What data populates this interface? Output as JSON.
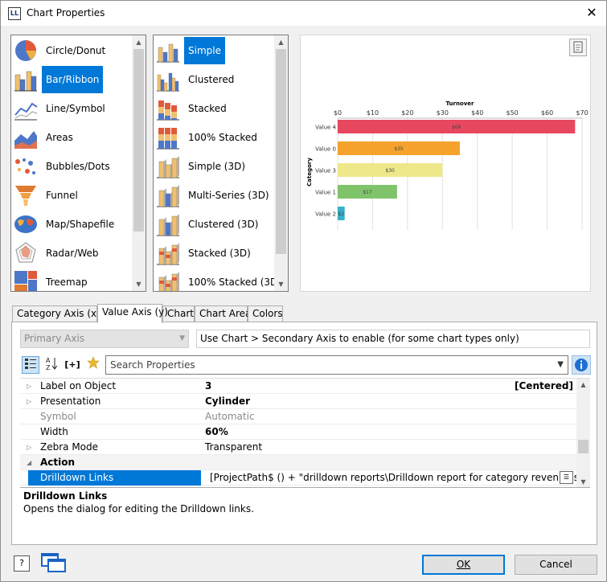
{
  "window": {
    "title": "Chart Properties",
    "app_icon_text": "LL",
    "close_label": "✕"
  },
  "chart_types": {
    "items": [
      {
        "label": "Circle/Donut",
        "icon": "pie-chart-icon"
      },
      {
        "label": "Bar/Ribbon",
        "icon": "bar-chart-icon",
        "selected": true
      },
      {
        "label": "Line/Symbol",
        "icon": "line-chart-icon"
      },
      {
        "label": "Areas",
        "icon": "area-chart-icon"
      },
      {
        "label": "Bubbles/Dots",
        "icon": "bubble-chart-icon"
      },
      {
        "label": "Funnel",
        "icon": "funnel-chart-icon"
      },
      {
        "label": "Map/Shapefile",
        "icon": "map-icon"
      },
      {
        "label": "Radar/Web",
        "icon": "radar-chart-icon"
      },
      {
        "label": "Treemap",
        "icon": "treemap-icon"
      }
    ]
  },
  "chart_subtypes": {
    "items": [
      {
        "label": "Simple",
        "selected": true
      },
      {
        "label": "Clustered"
      },
      {
        "label": "Stacked"
      },
      {
        "label": "100% Stacked"
      },
      {
        "label": "Simple (3D)"
      },
      {
        "label": "Multi-Series (3D)"
      },
      {
        "label": "Clustered (3D)"
      },
      {
        "label": "Stacked (3D)"
      },
      {
        "label": "100% Stacked (3D)"
      }
    ]
  },
  "preview": {
    "chart_data": {
      "type": "bar",
      "orientation": "horizontal",
      "title": "Turnover",
      "xlabel": "Turnover",
      "ylabel": "Category",
      "x_ticks": [
        "$0",
        "$10",
        "$20",
        "$30",
        "$40",
        "$50",
        "$60",
        "$70"
      ],
      "xlim": [
        0,
        70
      ],
      "grid": true,
      "categories": [
        "Value 4",
        "Value 0",
        "Value 3",
        "Value 1",
        "Value 2"
      ],
      "values": [
        68,
        35,
        30,
        17,
        2
      ],
      "data_labels": [
        "$68",
        "$35",
        "$30",
        "$17",
        "$2"
      ],
      "colors": [
        "#e8485f",
        "#f5a32d",
        "#eee88a",
        "#7fc46a",
        "#36b1c8"
      ]
    }
  },
  "tabs": [
    {
      "label": "Category Axis (x)"
    },
    {
      "label": "Value Axis (y)",
      "active": true
    },
    {
      "label": "Chart"
    },
    {
      "label": "Chart Area"
    },
    {
      "label": "Colors"
    }
  ],
  "axis_panel": {
    "axis_select": "Primary Axis",
    "note": "Use Chart > Secondary Axis to enable (for some chart types only)",
    "search_placeholder": "Search Properties",
    "toolbar": {
      "categorized_icon": "categorized-icon",
      "sort_icon": "sort-az-icon",
      "formula_label": "[+]",
      "favorite_icon": "star-icon"
    }
  },
  "properties": [
    {
      "name": "Label on Object",
      "value": "3",
      "extra": "[Centered]",
      "bold": true,
      "expander": "▷"
    },
    {
      "name": "Presentation",
      "value": "Cylinder",
      "bold": true,
      "expander": "▷"
    },
    {
      "name": "Symbol",
      "value": "Automatic",
      "disabled": true
    },
    {
      "name": "Width",
      "value": "60%",
      "bold": true
    },
    {
      "name": "Zebra Mode",
      "value": "Transparent",
      "expander": "▷"
    },
    {
      "name": "Action",
      "category": true,
      "expander": "◢"
    },
    {
      "name": "Drilldown Links",
      "value": "[ProjectPath$ () + \"drilldown reports\\Drilldown report for category revenue.srt\"]",
      "selected": true
    }
  ],
  "description": {
    "title": "Drilldown Links",
    "text": "Opens the dialog for editing the Drilldown links."
  },
  "buttons": {
    "ok": "OK",
    "cancel": "Cancel",
    "help": "?"
  }
}
